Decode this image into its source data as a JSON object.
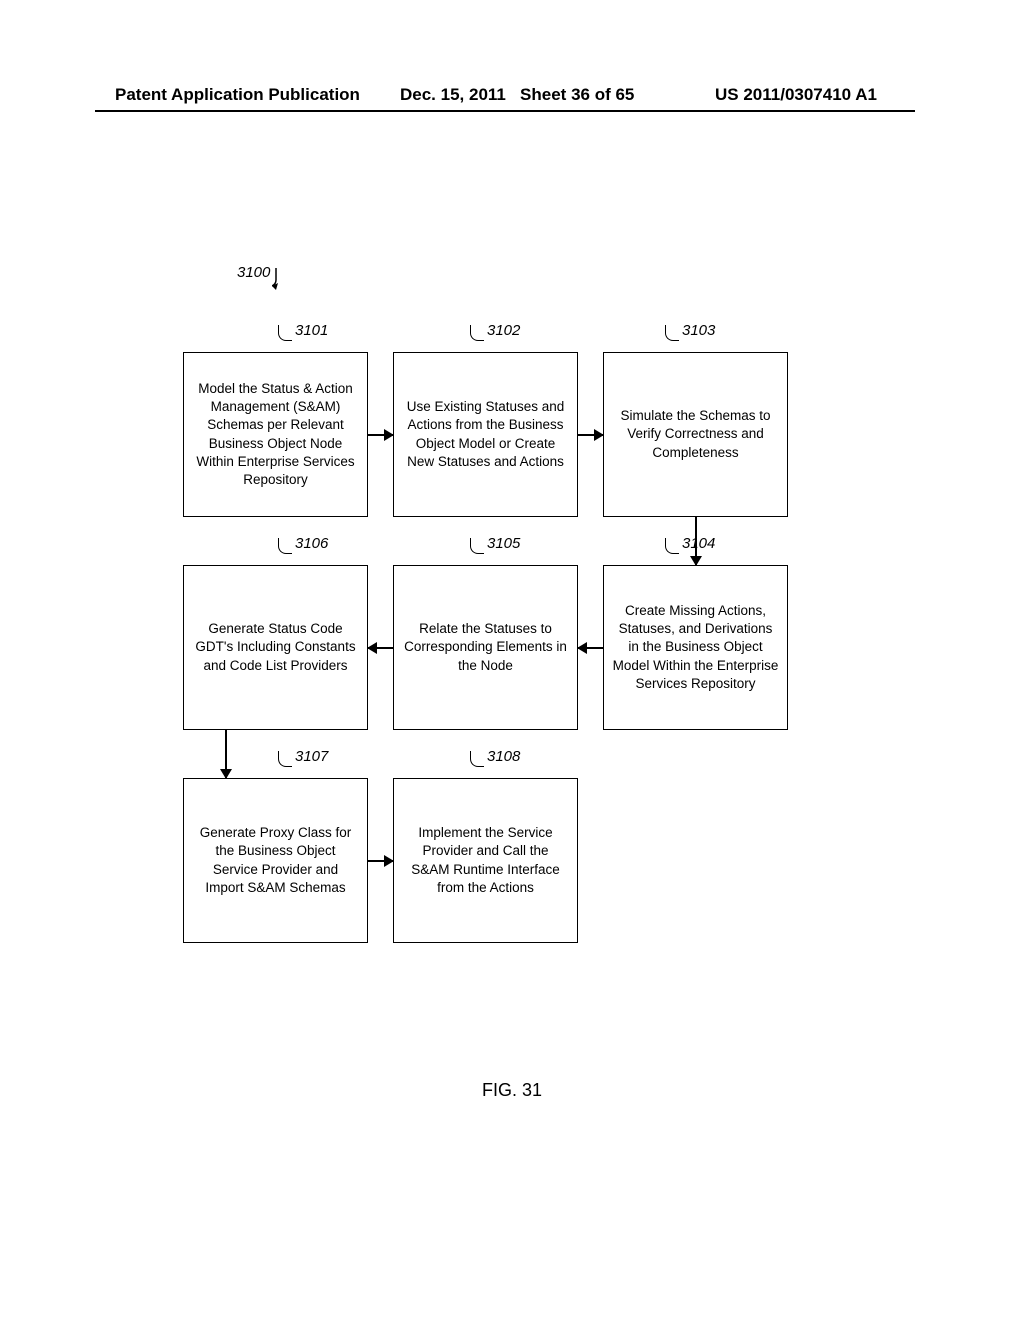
{
  "header": {
    "left": "Patent Application Publication",
    "date": "Dec. 15, 2011",
    "sheet": "Sheet 36 of 65",
    "pubnum": "US 2011/0307410 A1"
  },
  "labels": {
    "l3100": "3100",
    "l3101": "3101",
    "l3102": "3102",
    "l3103": "3103",
    "l3104": "3104",
    "l3105": "3105",
    "l3106": "3106",
    "l3107": "3107",
    "l3108": "3108"
  },
  "boxes": {
    "b3101": "Model the Status & Action Management (S&AM) Schemas per Relevant Business Object Node Within Enterprise Services Repository",
    "b3102": "Use Existing Statuses and Actions from the Business Object Model or Create New Statuses and Actions",
    "b3103": "Simulate the Schemas to Verify Correctness and Completeness",
    "b3104": "Create Missing Actions, Statuses, and Derivations in the Business Object Model Within the Enterprise Services Repository",
    "b3105": "Relate the Statuses to Corresponding Elements in the Node",
    "b3106": "Generate Status Code GDT's Including Constants and Code List Providers",
    "b3107": "Generate Proxy Class for the Business Object Service Provider and Import S&AM Schemas",
    "b3108": "Implement the Service Provider and Call the S&AM Runtime Interface from the Actions"
  },
  "figure": "FIG. 31"
}
